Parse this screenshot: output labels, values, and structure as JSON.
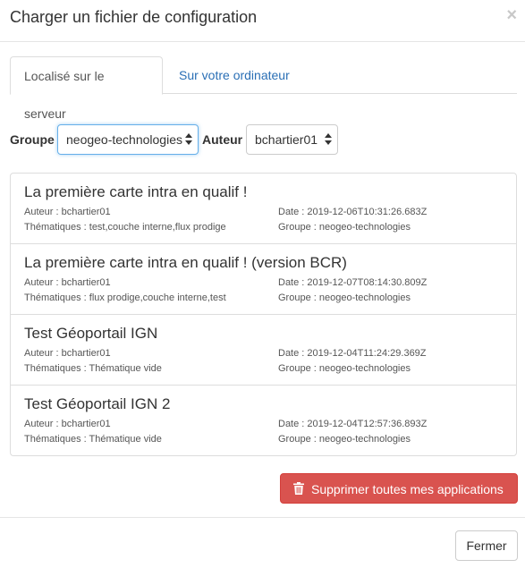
{
  "modal": {
    "title": "Charger un fichier de configuration",
    "close": "×"
  },
  "tabs": [
    {
      "label": "Localisé sur le serveur",
      "active": true
    },
    {
      "label": "Sur votre ordinateur",
      "active": false
    }
  ],
  "filters": {
    "group_label": "Groupe",
    "group_value": "neogeo-technologies",
    "author_label": "Auteur",
    "author_value": "bchartier01"
  },
  "items": [
    {
      "title": "La première carte intra en qualif !",
      "author": "Auteur : bchartier01",
      "date": "Date : 2019-12-06T10:31:26.683Z",
      "themes": "Thématiques : test,couche interne,flux prodige",
      "group": "Groupe : neogeo-technologies"
    },
    {
      "title": "La première carte intra en qualif ! (version BCR)",
      "author": "Auteur : bchartier01",
      "date": "Date : 2019-12-07T08:14:30.809Z",
      "themes": "Thématiques : flux prodige,couche interne,test",
      "group": "Groupe : neogeo-technologies"
    },
    {
      "title": "Test Géoportail IGN",
      "author": "Auteur : bchartier01",
      "date": "Date : 2019-12-04T11:24:29.369Z",
      "themes": "Thématiques : Thématique vide",
      "group": "Groupe : neogeo-technologies"
    },
    {
      "title": "Test Géoportail IGN 2",
      "author": "Auteur : bchartier01",
      "date": "Date : 2019-12-04T12:57:36.893Z",
      "themes": "Thématiques : Thématique vide",
      "group": "Groupe : neogeo-technologies"
    }
  ],
  "actions": {
    "delete_all_label": "Supprimer toutes mes applications",
    "close_label": "Fermer"
  },
  "colors": {
    "danger": "#d9534f",
    "link": "#2a6fb5",
    "focus": "#66afe9"
  }
}
